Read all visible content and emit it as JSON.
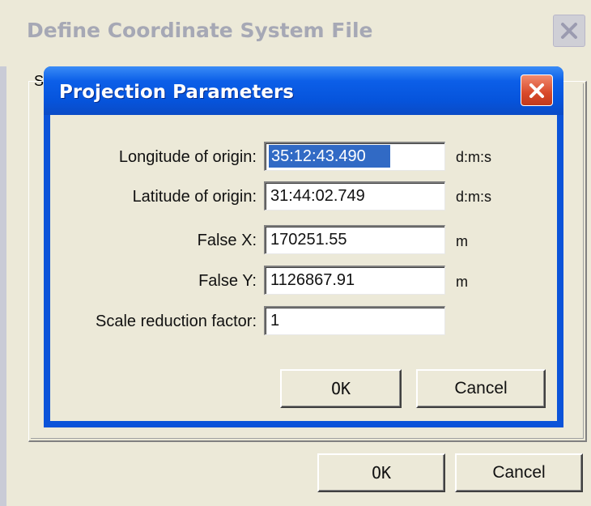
{
  "outer_window": {
    "title": "Define Coordinate System File",
    "tab_partial": "S",
    "ok_label": "OK",
    "cancel_label": "Cancel",
    "close_icon": "close-x-icon"
  },
  "dialog": {
    "title": "Projection Parameters",
    "close_icon": "close-x-icon",
    "fields": [
      {
        "label": "Longitude of origin:",
        "value": "35:12:43.490",
        "unit": "d:m:s",
        "selected": true
      },
      {
        "label": "Latitude of origin:",
        "value": "31:44:02.749",
        "unit": "d:m:s"
      },
      {
        "label": "False X:",
        "value": "170251.55",
        "unit": "m"
      },
      {
        "label": "False Y:",
        "value": "1126867.91",
        "unit": "m"
      },
      {
        "label": "Scale reduction factor:",
        "value": "1",
        "unit": ""
      }
    ],
    "ok_label": "OK",
    "cancel_label": "Cancel"
  },
  "colors": {
    "dialog_title_blue": "#0654dc",
    "close_red": "#d8492a",
    "window_face": "#ece9d8",
    "selection": "#316ac5"
  }
}
